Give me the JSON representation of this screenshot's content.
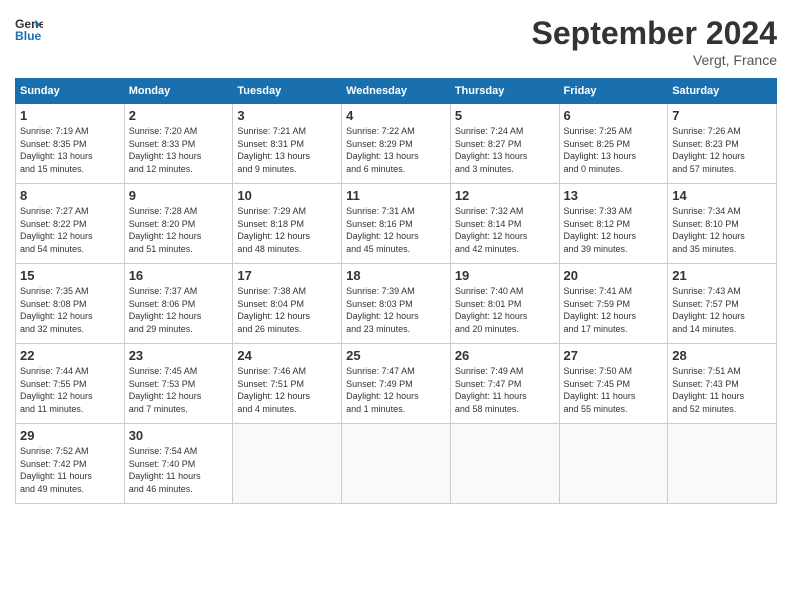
{
  "header": {
    "logo_line1": "General",
    "logo_line2": "Blue",
    "month_title": "September 2024",
    "location": "Vergt, France"
  },
  "days_of_week": [
    "Sunday",
    "Monday",
    "Tuesday",
    "Wednesday",
    "Thursday",
    "Friday",
    "Saturday"
  ],
  "weeks": [
    [
      {
        "num": "1",
        "sunrise": "7:19 AM",
        "sunset": "8:35 PM",
        "daylight": "13 hours and 15 minutes."
      },
      {
        "num": "2",
        "sunrise": "7:20 AM",
        "sunset": "8:33 PM",
        "daylight": "13 hours and 12 minutes."
      },
      {
        "num": "3",
        "sunrise": "7:21 AM",
        "sunset": "8:31 PM",
        "daylight": "13 hours and 9 minutes."
      },
      {
        "num": "4",
        "sunrise": "7:22 AM",
        "sunset": "8:29 PM",
        "daylight": "13 hours and 6 minutes."
      },
      {
        "num": "5",
        "sunrise": "7:24 AM",
        "sunset": "8:27 PM",
        "daylight": "13 hours and 3 minutes."
      },
      {
        "num": "6",
        "sunrise": "7:25 AM",
        "sunset": "8:25 PM",
        "daylight": "13 hours and 0 minutes."
      },
      {
        "num": "7",
        "sunrise": "7:26 AM",
        "sunset": "8:23 PM",
        "daylight": "12 hours and 57 minutes."
      }
    ],
    [
      {
        "num": "8",
        "sunrise": "7:27 AM",
        "sunset": "8:22 PM",
        "daylight": "12 hours and 54 minutes."
      },
      {
        "num": "9",
        "sunrise": "7:28 AM",
        "sunset": "8:20 PM",
        "daylight": "12 hours and 51 minutes."
      },
      {
        "num": "10",
        "sunrise": "7:29 AM",
        "sunset": "8:18 PM",
        "daylight": "12 hours and 48 minutes."
      },
      {
        "num": "11",
        "sunrise": "7:31 AM",
        "sunset": "8:16 PM",
        "daylight": "12 hours and 45 minutes."
      },
      {
        "num": "12",
        "sunrise": "7:32 AM",
        "sunset": "8:14 PM",
        "daylight": "12 hours and 42 minutes."
      },
      {
        "num": "13",
        "sunrise": "7:33 AM",
        "sunset": "8:12 PM",
        "daylight": "12 hours and 39 minutes."
      },
      {
        "num": "14",
        "sunrise": "7:34 AM",
        "sunset": "8:10 PM",
        "daylight": "12 hours and 35 minutes."
      }
    ],
    [
      {
        "num": "15",
        "sunrise": "7:35 AM",
        "sunset": "8:08 PM",
        "daylight": "12 hours and 32 minutes."
      },
      {
        "num": "16",
        "sunrise": "7:37 AM",
        "sunset": "8:06 PM",
        "daylight": "12 hours and 29 minutes."
      },
      {
        "num": "17",
        "sunrise": "7:38 AM",
        "sunset": "8:04 PM",
        "daylight": "12 hours and 26 minutes."
      },
      {
        "num": "18",
        "sunrise": "7:39 AM",
        "sunset": "8:03 PM",
        "daylight": "12 hours and 23 minutes."
      },
      {
        "num": "19",
        "sunrise": "7:40 AM",
        "sunset": "8:01 PM",
        "daylight": "12 hours and 20 minutes."
      },
      {
        "num": "20",
        "sunrise": "7:41 AM",
        "sunset": "7:59 PM",
        "daylight": "12 hours and 17 minutes."
      },
      {
        "num": "21",
        "sunrise": "7:43 AM",
        "sunset": "7:57 PM",
        "daylight": "12 hours and 14 minutes."
      }
    ],
    [
      {
        "num": "22",
        "sunrise": "7:44 AM",
        "sunset": "7:55 PM",
        "daylight": "12 hours and 11 minutes."
      },
      {
        "num": "23",
        "sunrise": "7:45 AM",
        "sunset": "7:53 PM",
        "daylight": "12 hours and 7 minutes."
      },
      {
        "num": "24",
        "sunrise": "7:46 AM",
        "sunset": "7:51 PM",
        "daylight": "12 hours and 4 minutes."
      },
      {
        "num": "25",
        "sunrise": "7:47 AM",
        "sunset": "7:49 PM",
        "daylight": "12 hours and 1 minute."
      },
      {
        "num": "26",
        "sunrise": "7:49 AM",
        "sunset": "7:47 PM",
        "daylight": "11 hours and 58 minutes."
      },
      {
        "num": "27",
        "sunrise": "7:50 AM",
        "sunset": "7:45 PM",
        "daylight": "11 hours and 55 minutes."
      },
      {
        "num": "28",
        "sunrise": "7:51 AM",
        "sunset": "7:43 PM",
        "daylight": "11 hours and 52 minutes."
      }
    ],
    [
      {
        "num": "29",
        "sunrise": "7:52 AM",
        "sunset": "7:42 PM",
        "daylight": "11 hours and 49 minutes."
      },
      {
        "num": "30",
        "sunrise": "7:54 AM",
        "sunset": "7:40 PM",
        "daylight": "11 hours and 46 minutes."
      },
      null,
      null,
      null,
      null,
      null
    ]
  ]
}
